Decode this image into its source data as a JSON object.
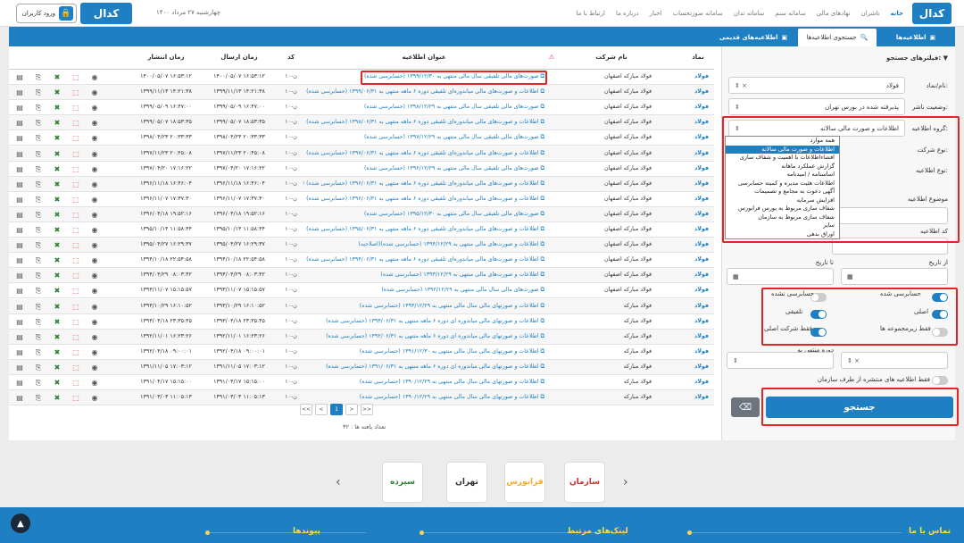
{
  "header": {
    "logo_text": "کدال",
    "nav": [
      "خانه",
      "ناشران",
      "نهادهای مالی",
      "سامانه سنم",
      "سامانه تدان",
      "سامانه صورتحساب",
      "اخبار",
      "درباره ما",
      "ارتباط با ما"
    ],
    "date": "چهارشنبه ۲۷ مرداد ۱۴۰۰",
    "login_label": "ورود کاربران",
    "logo2_text": "کدال"
  },
  "tabs": {
    "announcements": "اطلاعیه‌ها",
    "search": "جستجوی اطلاعیه‌ها",
    "old": "اطلاعیه‌های قدیمی"
  },
  "filters": {
    "title": "فیلترهای جستجو:",
    "symbol_label": "نام/نماد:",
    "symbol_value": "فولاد",
    "status_label": "وضعیت ناشر:",
    "status_value": "پذیرفته شده در بورس تهران",
    "group_label": "گروه اطلاعیه:",
    "group_value": "اطلاعات و صورت مالی سالانه",
    "company_type_label": "نوع شرکت:",
    "letter_type_label": "نوع اطلاعیه:",
    "subject_label": "موضوع اطلاعیه",
    "code_label": "کد اطلاعیه",
    "from_date_label": "از تاریخ",
    "to_date_label": "تا تاریخ",
    "audited_label": "حسابرسی شده",
    "not_audited_label": "حسابرسی نشده",
    "original_label": "اصلی",
    "consolidated_label": "تلفیقی",
    "sub_label": "فقط زیرمجموعه ها",
    "parent_label": "فقط شرکت اصلی",
    "period_label": "دوره منتهی به",
    "year_end_label": "سال مالی منتهی به",
    "org_only_label": "فقط اطلاعیه های منتشره از طرف سازمان",
    "search_button": "جستجو",
    "clear_icon": "eraser-icon",
    "toggles": {
      "audited": true,
      "not_audited": false,
      "original": true,
      "consolidated": true,
      "sub": false,
      "parent": true,
      "org_only": false
    }
  },
  "dropdown_options": [
    "همه موارد",
    "اطلاعات و صورت مالی سالانه",
    "افشاءاطلاعات با اهمیت و شفاف سازی",
    "گزارش عملکرد ماهانه",
    "اساسنامه / امیدنامه",
    "اطلاعات هئیت مدیره و کمیته حسابرسی",
    "آگهی دعوت به مجامع و تصمیمات",
    "افزایش سرمایه",
    "شفاف سازی مربوط به بورس فرابورس",
    "شفاف سازی مربوط به سازمان",
    "سایر",
    "اوراق بدهی"
  ],
  "dropdown_selected": 1,
  "table": {
    "headers": {
      "symbol": "نماد",
      "company": "نام شرکت",
      "title": "عنوان اطلاعیه",
      "code": "کد",
      "sent": "زمان ارسال",
      "published": "زمان انتشار"
    },
    "rows": [
      {
        "symbol": "فولاد",
        "company": "فولاد مبارکه اصفهان",
        "title": "صورت‌های مالی تلفیقی سال مالی منتهی به ۱۳۹۹/۱۲/۳۰ (حسابرسی شده)",
        "code": "ن-۱۰",
        "sent": "۱۴۰۰/۰۵/۰۷ ۱۶:۵۳:۱۲",
        "published": "۱۴۰۰/۰۵/۰۷ ۱۶:۵۳:۱۲"
      },
      {
        "symbol": "فولاد",
        "company": "فولاد مبارکه اصفهان",
        "title": "اطلاعات و صورت‌های مالی میاندوره‌ای تلفیقی دوره ۶ ماهه منتهی به ۱۳۹۹/۰۶/۳۱ (حسابرسی شده)",
        "code": "ن-۱۰",
        "sent": "۱۳۹۹/۱۱/۱۳ ۱۴:۲۱:۳۸",
        "published": "۱۳۹۹/۱۱/۱۳ ۱۴:۲۱:۳۸"
      },
      {
        "symbol": "فولاد",
        "company": "فولاد مبارکه اصفهان",
        "title": "صورت‌های مالی تلفیقی سال مالی منتهی به ۱۳۹۸/۱۲/۲۹ (حسابرسی شده)",
        "code": "ن-۱۰",
        "sent": "۱۳۹۹/۰۵/۰۹ ۱۶:۴۷:۰۰",
        "published": "۱۳۹۹/۰۵/۰۹ ۱۶:۴۷:۰۰"
      },
      {
        "symbol": "فولاد",
        "company": "فولاد مبارکه اصفهان",
        "title": "اطلاعات و صورت‌های مالی میاندوره‌ای تلفیقی دوره ۶ ماهه منتهی به ۱۳۹۸/۰۶/۳۱ (حسابرسی شده)",
        "code": "ن-۱۰",
        "sent": "۱۳۹۹/۰۵/۰۷ ۱۸:۵۳:۳۵",
        "published": "۱۳۹۹/۰۵/۰۷ ۱۸:۵۳:۳۵"
      },
      {
        "symbol": "فولاد",
        "company": "فولاد مبارکه اصفهان",
        "title": "صورت‌های مالی تلفیقی سال مالی منتهی به ۱۳۹۷/۱۲/۲۹ (حسابرسی شده)",
        "code": "ن-۱۰",
        "sent": "۱۳۹۸/۰۴/۲۳ ۲۰:۳۳:۳۳",
        "published": "۱۳۹۸/۰۴/۲۳ ۲۰:۳۳:۳۳"
      },
      {
        "symbol": "فولاد",
        "company": "فولاد مبارکه اصفهان",
        "title": "اطلاعات و صورت‌های مالی میاندوره‌ای تلفیقی دوره ۶ ماهه منتهی به ۱۳۹۷/۰۶/۳۱ (حسابرسی شده)",
        "code": "ن-۱۰",
        "sent": "۱۳۹۷/۱۱/۲۳ ۲۰:۴۵:۰۸",
        "published": "۱۳۹۷/۱۱/۲۳ ۲۰:۴۵:۰۸"
      },
      {
        "symbol": "فولاد",
        "company": "فولاد مبارکه اصفهان",
        "title": "صورت‌های مالی تلفیقی سال مالی منتهی به ۱۳۹۶/۱۲/۲۹ (حسابرسی شده)",
        "code": "ن-۱۰",
        "sent": "۱۳۹۷/۰۴/۲۰ ۱۷:۱۶:۲۲",
        "published": "۱۳۹۷/۰۴/۲۰ ۱۷:۱۶:۲۲"
      },
      {
        "symbol": "فولاد",
        "company": "فولاد مبارکه اصفهان",
        "title": "اطلاعات و صورت‌های مالی میاندوره‌ای تلفیقی دوره ۶ ماهه منتهی به ۱۳۹۶/۰۶/۳۱ (حسابرسی شده) (اصلاحیه)",
        "code": "ن-۱۰",
        "sent": "۱۳۹۶/۱۱/۱۸ ۱۶:۴۶:۰۴",
        "published": "۱۳۹۶/۱۱/۱۸ ۱۶:۴۶:۰۴"
      },
      {
        "symbol": "فولاد",
        "company": "فولاد مبارکه اصفهان",
        "title": "اطلاعات و صورت‌های مالی میاندوره‌ای تلفیقی دوره ۶ ماهه منتهی به ۱۳۹۶/۰۶/۳۱ (حسابرسی شده)",
        "code": "ن-۱۰",
        "sent": "۱۳۹۶/۱۱/۰۷ ۱۷:۳۷:۳۰",
        "published": "۱۳۹۶/۱۱/۰۷ ۱۷:۳۷:۳۰"
      },
      {
        "symbol": "فولاد",
        "company": "فولاد مبارکه اصفهان",
        "title": "صورت‌های مالی تلفیقی سال مالی منتهی به ۱۳۹۵/۱۲/۳۰ (حسابرسی شده)",
        "code": "ن-۱۰",
        "sent": "۱۳۹۶/۰۴/۱۸ ۱۹:۵۲:۱۶",
        "published": "۱۳۹۶/۰۴/۱۸ ۱۹:۵۲:۱۶"
      },
      {
        "symbol": "فولاد",
        "company": "فولاد مبارکه اصفهان",
        "title": "اطلاعات و صورت‌های مالی میاندوره‌ای تلفیقی دوره ۶ ماهه منتهی به ۱۳۹۵/۰۶/۳۱ (حسابرسی شده)",
        "code": "ن-۱۰",
        "sent": "۱۳۹۵/۱۰/۱۴ ۱۱:۵۸:۴۴",
        "published": "۱۳۹۵/۱۰/۱۴ ۱۱:۵۸:۴۴"
      },
      {
        "symbol": "فولاد",
        "company": "فولاد مبارکه اصفهان",
        "title": "اطلاعات و صورت‌های مالی منتهی به ۱۳۹۴/۱۲/۲۹ (حسابرسی شده)(اصلاحیه)",
        "code": "ن-۱۰",
        "sent": "۱۳۹۵/۰۴/۲۷ ۱۶:۲۹:۳۷",
        "published": "۱۳۹۵/۰۴/۲۷ ۱۶:۲۹:۳۷"
      },
      {
        "symbol": "فولاد",
        "company": "فولاد مبارکه اصفهان",
        "title": "اطلاعات و صورت‌های مالی میاندوره‌ای تلفیقی دوره ۶ ماهه منتهی به ۱۳۹۴/۰۶/۳۱ (حسابرسی شده)",
        "code": "ن-۱۰",
        "sent": "۱۳۹۴/۱۰/۱۸ ۲۲:۵۴:۵۸",
        "published": "۱۳۹۴/۱۰/۱۸ ۲۲:۵۴:۵۸"
      },
      {
        "symbol": "فولاد",
        "company": "فولاد مبارکه اصفهان",
        "title": "اطلاعات و صورت‌های مالی منتهی به ۱۳۹۳/۱۲/۲۹ (حسابرسی شده)",
        "code": "ن-۱۰",
        "sent": "۱۳۹۴/۰۴/۲۹ ۰۸:۰۳:۴۲",
        "published": "۱۳۹۴/۰۴/۲۹ ۰۸:۰۳:۴۲"
      },
      {
        "symbol": "فولاد",
        "company": "فولاد مبارکه اصفهان",
        "title": "صورت‌های مالی سال مالی منتهی به ۱۳۹۲/۱۲/۲۹ (حسابرسی شده)",
        "code": "ن-۱۰",
        "sent": "۱۳۹۳/۱۱/۰۷ ۱۵:۱۵:۵۷",
        "published": "۱۳۹۳/۱۱/۰۷ ۱۵:۱۵:۵۷"
      },
      {
        "symbol": "فولاد",
        "company": "فولاد مبارکه",
        "title": "اطلاعات و صورتهای مالی سال مالی منتهی به ۱۳۹۳/۱۲/۲۹ (حسابرسی شده)",
        "code": "ن-۱۰",
        "sent": "۱۳۹۳/۱۰/۲۹ ۱۶:۱۰:۵۲",
        "published": "۱۳۹۳/۱۰/۲۹ ۱۶:۱۰:۵۲"
      },
      {
        "symbol": "فولاد",
        "company": "فولاد مبارکه",
        "title": "اطلاعات و صورتهای مالی میاندوره ای دوره ۶ ماهه منتهی به ۱۳۹۳/۰۶/۳۱ (حسابرسی شده)",
        "code": "ن-۱۰",
        "sent": "۱۳۹۳/۰۴/۱۸ ۲۳:۳۵:۴۵",
        "published": "۱۳۹۳/۰۴/۱۸ ۲۳:۳۵:۴۵"
      },
      {
        "symbol": "فولاد",
        "company": "فولاد مبارکه",
        "title": "اطلاعات و صورتهای مالی میاندوره ای دوره ۶ ماهه منتهی به ۱۳۹۲/۰۶/۳۱ (حسابرسی شده)",
        "code": "ن-۱۰",
        "sent": "۱۳۹۲/۱۱/۰۱ ۱۶:۲۳:۲۶",
        "published": "۱۳۹۲/۱۱/۰۱ ۱۶:۲۳:۲۶"
      },
      {
        "symbol": "فولاد",
        "company": "فولاد مبارکه",
        "title": "اطلاعات و صورتهای مالی سال مالی منتهی به ۱۳۹۱/۱۲/۳۰ (حسابرسی شده)",
        "code": "ن-۱۰",
        "sent": "۱۳۹۲/۰۴/۱۸ ۰۹:۰۰:۰۱",
        "published": "۱۳۹۲/۰۴/۱۸ ۰۹:۰۰:۰۱"
      },
      {
        "symbol": "فولاد",
        "company": "فولاد مبارکه",
        "title": "اطلاعات و صورتهای مالی میاندوره ای دوره ۶ ماهه منتهی به ۱۳۹۱/۰۶/۳۱ (حسابرسی شده)",
        "code": "ن-۱۰",
        "sent": "۱۳۹۱/۱۱/۰۵ ۱۷:۰۳:۱۲",
        "published": "۱۳۹۱/۱۱/۰۵ ۱۷:۰۳:۱۲"
      },
      {
        "symbol": "فولاد",
        "company": "فولاد مبارکه",
        "title": "اطلاعات و صورتهای مالی سال مالی منتهی به ۱۳۹۰/۱۲/۲۹ (حسابرسی شده)",
        "code": "ن-۱۰",
        "sent": "۱۳۹۱/۰۴/۱۷ ۱۵:۱۵:۰۰",
        "published": "۱۳۹۱/۰۴/۱۷ ۱۵:۱۵:۰۰"
      },
      {
        "symbol": "فولاد",
        "company": "فولاد مبارکه",
        "title": "اطلاعات و صورتهای مالی سال مالی منتهی به ۱۳۹۰/۱۲/۲۹ (حسابرسی شده)",
        "code": "ن-۱۰",
        "sent": "۱۳۹۱/۰۳/۰۳ ۱۱:۰۵:۱۳",
        "published": "۱۳۹۱/۰۳/۰۳ ۱۱:۰۵:۱۳"
      }
    ]
  },
  "pager": {
    "pages": [
      "<<",
      "<",
      "1",
      ">",
      ">>"
    ],
    "current": "1",
    "total_label": "تعداد یافته ها : ۳۲"
  },
  "carousel": {
    "logos": [
      "سازمان",
      "تهران",
      "فرابورس",
      "سپرده"
    ]
  },
  "footer": {
    "items": [
      "تماس با ما",
      "لینک‌های مرتبط",
      "پیوندها"
    ]
  }
}
